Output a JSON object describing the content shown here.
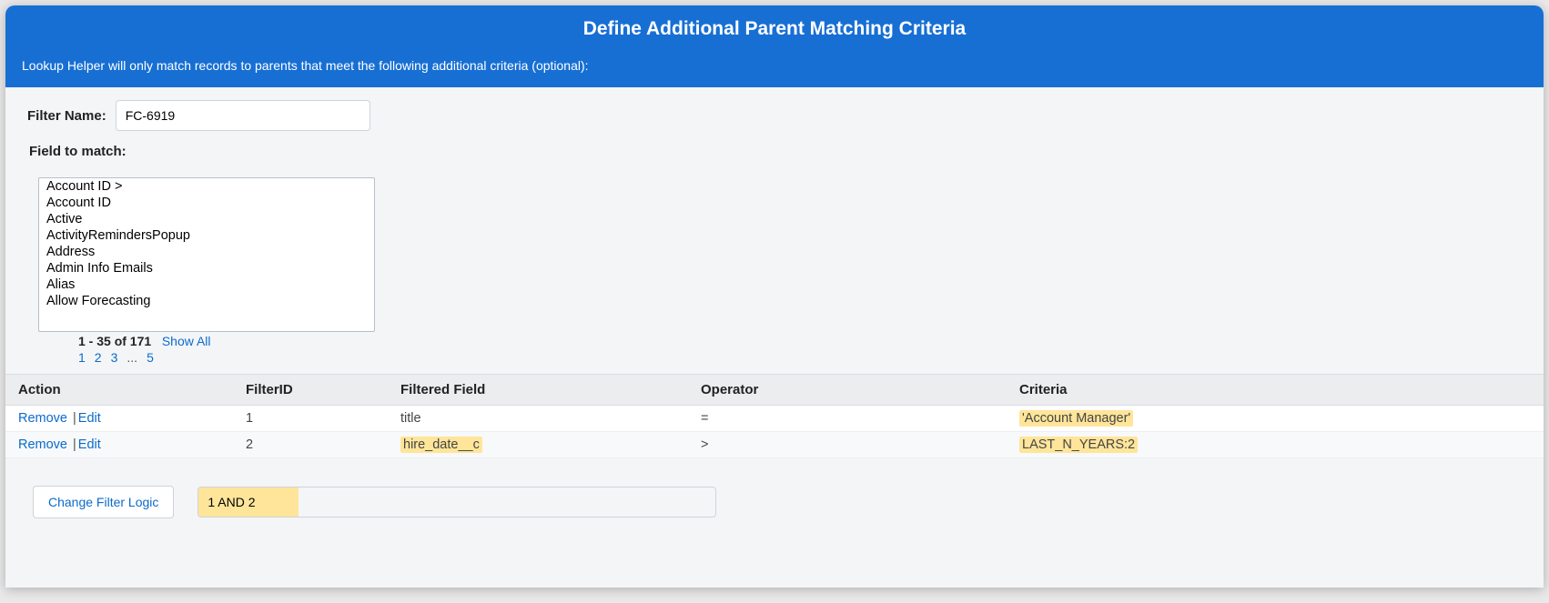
{
  "header": {
    "title": "Define Additional Parent Matching Criteria",
    "subtitle": "Lookup Helper will only match records to parents that meet the following additional criteria (optional):"
  },
  "filter_name": {
    "label": "Filter Name:",
    "value": "FC-6919"
  },
  "field_to_match": {
    "label": "Field to match:",
    "options": [
      "Account ID >",
      "Account ID",
      "Active",
      "ActivityRemindersPopup",
      "Address",
      "Admin Info Emails",
      "Alias",
      "Allow Forecasting"
    ],
    "count_text": "1 - 35 of 171",
    "show_all": "Show All",
    "pages": [
      "1",
      "2",
      "3",
      "...",
      "5"
    ]
  },
  "grid": {
    "headers": {
      "action": "Action",
      "filter_id": "FilterID",
      "field": "Filtered Field",
      "operator": "Operator",
      "criteria": "Criteria"
    },
    "remove": "Remove",
    "edit": "Edit",
    "rows": [
      {
        "id": "1",
        "field": "title",
        "field_hl": false,
        "operator": "=",
        "criteria": "'Account Manager'",
        "criteria_hl": true
      },
      {
        "id": "2",
        "field": "hire_date__c",
        "field_hl": true,
        "operator": ">",
        "criteria": "LAST_N_YEARS:2",
        "criteria_hl": true
      }
    ]
  },
  "logic": {
    "button": "Change Filter Logic",
    "value": "1 AND 2"
  }
}
